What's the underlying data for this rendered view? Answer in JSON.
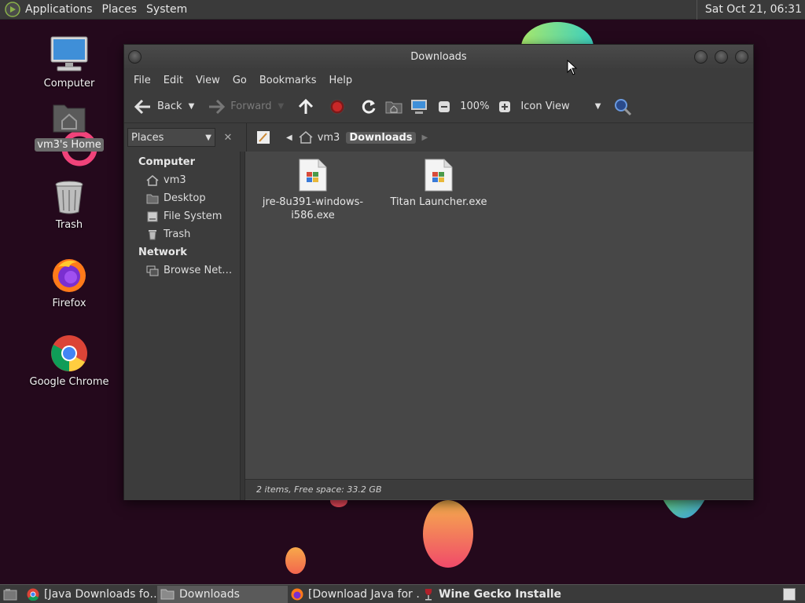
{
  "top_panel": {
    "menus": [
      "Applications",
      "Places",
      "System"
    ],
    "clock": "Sat Oct 21, 06:31"
  },
  "desktop": {
    "icons": [
      {
        "label": "Computer",
        "icon": "computer-icon"
      },
      {
        "label": "vm3's Home",
        "icon": "home-folder-icon",
        "selected": true
      },
      {
        "label": "Trash",
        "icon": "trash-icon"
      },
      {
        "label": "Firefox",
        "icon": "firefox-icon"
      },
      {
        "label": "Google Chrome",
        "icon": "chrome-icon"
      }
    ]
  },
  "window": {
    "title": "Downloads",
    "menus": [
      "File",
      "Edit",
      "View",
      "Go",
      "Bookmarks",
      "Help"
    ],
    "toolbar": {
      "back": "Back",
      "forward": "Forward",
      "zoom": "100%",
      "view_mode": "Icon View"
    },
    "location": {
      "sidebar_mode": "Places",
      "crumbs": [
        "vm3",
        "Downloads"
      ]
    },
    "sidebar": {
      "sections": [
        {
          "title": "Computer",
          "items": [
            {
              "label": "vm3",
              "icon": "home-icon"
            },
            {
              "label": "Desktop",
              "icon": "desktop-folder-icon"
            },
            {
              "label": "File System",
              "icon": "drive-icon"
            },
            {
              "label": "Trash",
              "icon": "trash-icon"
            }
          ]
        },
        {
          "title": "Network",
          "items": [
            {
              "label": "Browse Net…",
              "icon": "network-icon"
            }
          ]
        }
      ]
    },
    "files": [
      {
        "name_line1": "jre-8u391-windows-",
        "name_line2": "i586.exe"
      },
      {
        "name_line1": "Titan Launcher.exe",
        "name_line2": ""
      }
    ],
    "status": "2 items, Free space: 33.2 GB"
  },
  "taskbar": {
    "tasks": [
      {
        "label": "[Java Downloads fo…",
        "icon": "chrome-icon"
      },
      {
        "label": "Downloads",
        "icon": "folder-icon",
        "active": true
      },
      {
        "label": "[Download Java for …",
        "icon": "firefox-icon"
      },
      {
        "label": "Wine Gecko Installer",
        "icon": "wine-icon",
        "bold": true
      }
    ]
  },
  "colors": {
    "desktop_bg": "#24091c",
    "panel": "#3a3a3a",
    "window_bg": "#3c3c3c",
    "iconview_bg": "#474747"
  }
}
